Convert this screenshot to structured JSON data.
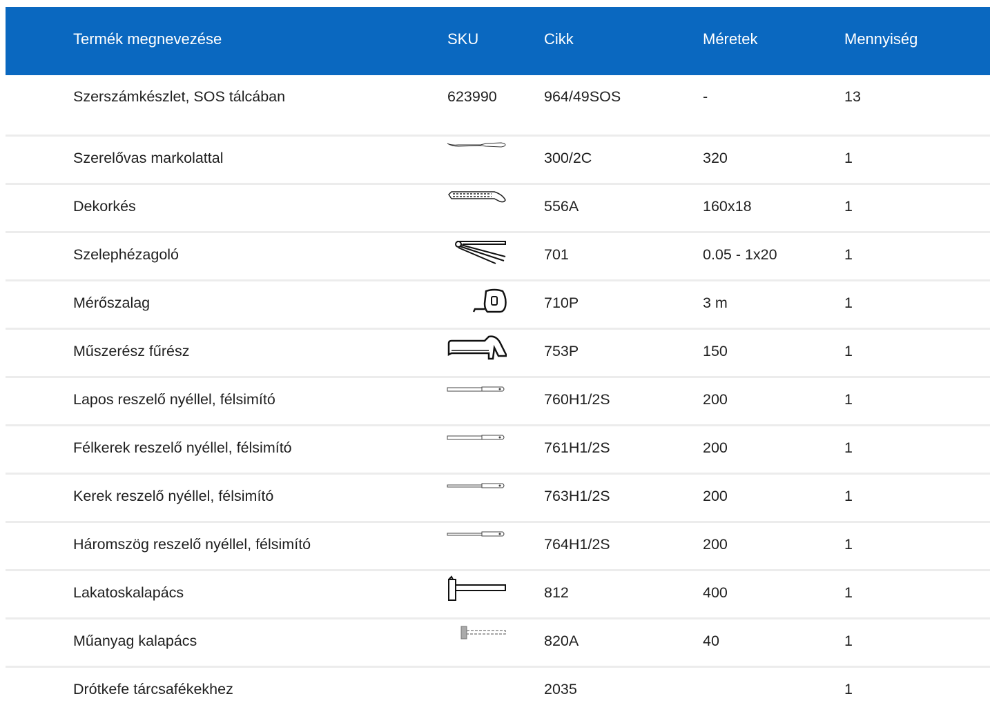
{
  "headers": {
    "name": "Termék megnevezése",
    "sku": "SKU",
    "article": "Cikk",
    "size": "Méretek",
    "qty": "Mennyiség"
  },
  "rows": [
    {
      "name": "Szerszámkészlet, SOS tálcában",
      "sku": "623990",
      "article": "964/49SOS",
      "size": "-",
      "qty": "13",
      "icon": ""
    },
    {
      "name": "Szerelővas markolattal",
      "sku": "",
      "article": "300/2C",
      "size": "320",
      "qty": "1",
      "icon": "pry-bar-icon"
    },
    {
      "name": "Dekorkés",
      "sku": "",
      "article": "556A",
      "size": "160x18",
      "qty": "1",
      "icon": "utility-knife-icon"
    },
    {
      "name": "Szelephézagoló",
      "sku": "",
      "article": "701",
      "size": "0.05 - 1x20",
      "qty": "1",
      "icon": "feeler-gauge-icon"
    },
    {
      "name": "Mérőszalag",
      "sku": "",
      "article": "710P",
      "size": "3 m",
      "qty": "1",
      "icon": "tape-measure-icon"
    },
    {
      "name": "Műszerész fűrész",
      "sku": "",
      "article": "753P",
      "size": "150",
      "qty": "1",
      "icon": "hacksaw-icon"
    },
    {
      "name": "Lapos reszelő nyéllel, félsimító",
      "sku": "",
      "article": "760H1/2S",
      "size": "200",
      "qty": "1",
      "icon": "flat-file-icon"
    },
    {
      "name": "Félkerek reszelő nyéllel, félsimító",
      "sku": "",
      "article": "761H1/2S",
      "size": "200",
      "qty": "1",
      "icon": "half-round-file-icon"
    },
    {
      "name": "Kerek reszelő nyéllel, félsimító",
      "sku": "",
      "article": "763H1/2S",
      "size": "200",
      "qty": "1",
      "icon": "round-file-icon"
    },
    {
      "name": "Háromszög reszelő nyéllel, félsimító",
      "sku": "",
      "article": "764H1/2S",
      "size": "200",
      "qty": "1",
      "icon": "triangle-file-icon"
    },
    {
      "name": "Lakatoskalapács",
      "sku": "",
      "article": "812",
      "size": "400",
      "qty": "1",
      "icon": "hammer-icon"
    },
    {
      "name": "Műanyag kalapács",
      "sku": "",
      "article": "820A",
      "size": "40",
      "qty": "1",
      "icon": "plastic-mallet-icon"
    },
    {
      "name": "Drótkefe tárcsafékekhez",
      "sku": "",
      "article": "2035",
      "size": "",
      "qty": "1",
      "icon": ""
    }
  ],
  "colors": {
    "header_bg": "#0a68c0",
    "header_text": "#ffffff",
    "row_divider": "#ececec"
  }
}
